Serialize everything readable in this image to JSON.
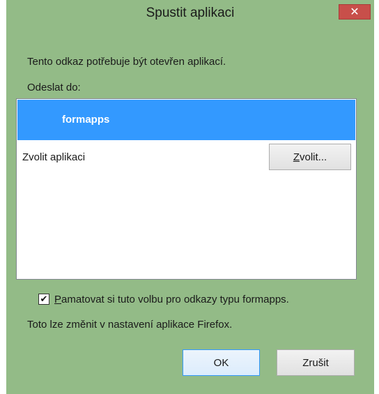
{
  "window": {
    "title": "Spustit aplikaci",
    "close_glyph": "✕"
  },
  "dialog": {
    "intro_text": "Tento odkaz potřebuje být otevřen aplikací.",
    "send_to_label": "Odeslat do:",
    "list": {
      "selected_item": "formapps",
      "choose_app_label": "Zvolit aplikaci",
      "choose_button_accel": "Z",
      "choose_button_rest": "volit..."
    },
    "remember_checkbox": {
      "checked": true,
      "check_glyph": "✔",
      "accel": "P",
      "label_rest": "amatovat si tuto volbu pro odkazy typu formapps."
    },
    "hint_text": "Toto lze změnit v nastavení aplikace Firefox.",
    "ok_label": "OK",
    "cancel_label": "Zrušit"
  },
  "colors": {
    "window_frame": "#93bb87",
    "selection": "#3399ff",
    "close_button": "#c84f4a"
  }
}
